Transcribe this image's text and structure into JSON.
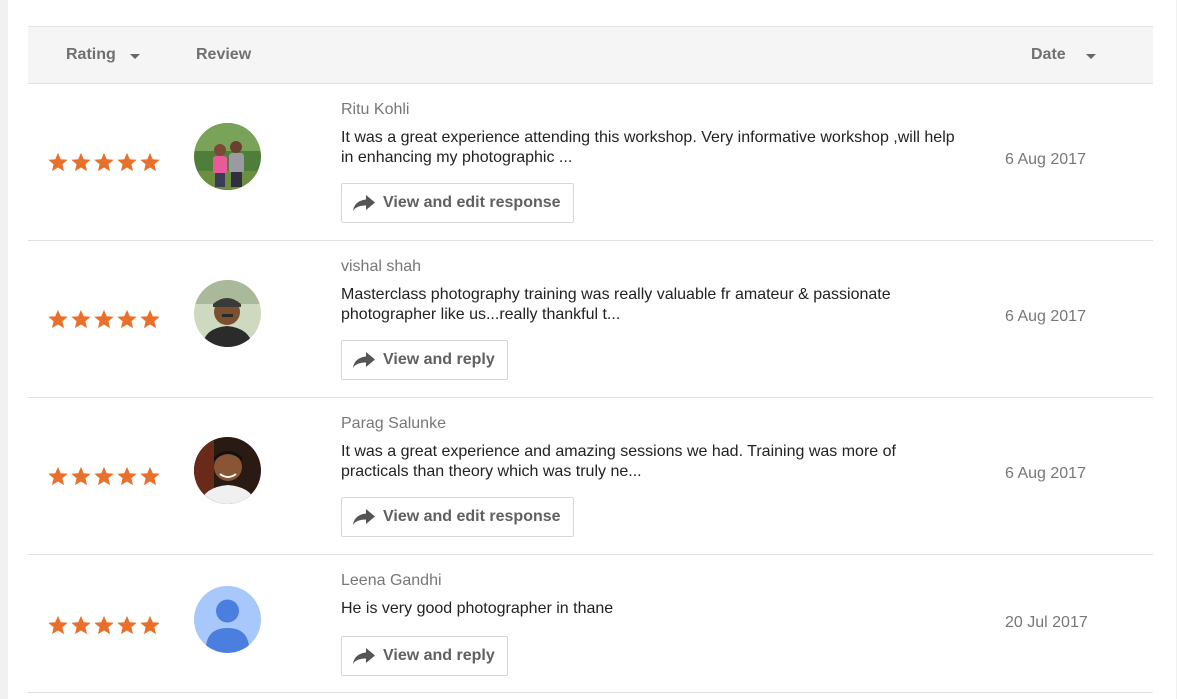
{
  "table": {
    "headers": {
      "rating": "Rating",
      "review": "Review",
      "date": "Date"
    },
    "reviews": [
      {
        "rating": 5,
        "name": "Ritu Kohli",
        "text": "It was a great experience attending this workshop. Very informative workshop ,will help in enhancing my photographic ...",
        "action": "View and edit response",
        "date": "6 Aug 2017"
      },
      {
        "rating": 5,
        "name": "vishal shah",
        "text": "Masterclass photography training was really valuable fr amateur & passionate photographer like us...really thankful t...",
        "action": "View and reply",
        "date": "6 Aug 2017"
      },
      {
        "rating": 5,
        "name": "Parag Salunke",
        "text": "It was a great experience and amazing sessions we had. Training was more of practicals than theory which was truly ne...",
        "action": "View and edit response",
        "date": "6 Aug 2017"
      },
      {
        "rating": 5,
        "name": "Leena Gandhi",
        "text": "He is very good photographer in thane",
        "action": "View and reply",
        "date": "20 Jul 2017"
      }
    ]
  },
  "colors": {
    "star": "#e8702a",
    "default_avatar_bg": "#a8c7fa",
    "default_avatar_fg": "#4a7fe0"
  },
  "icons": {
    "sort": "caret-down-icon",
    "reply": "reply-arrow-icon",
    "rating": "star-icon"
  }
}
